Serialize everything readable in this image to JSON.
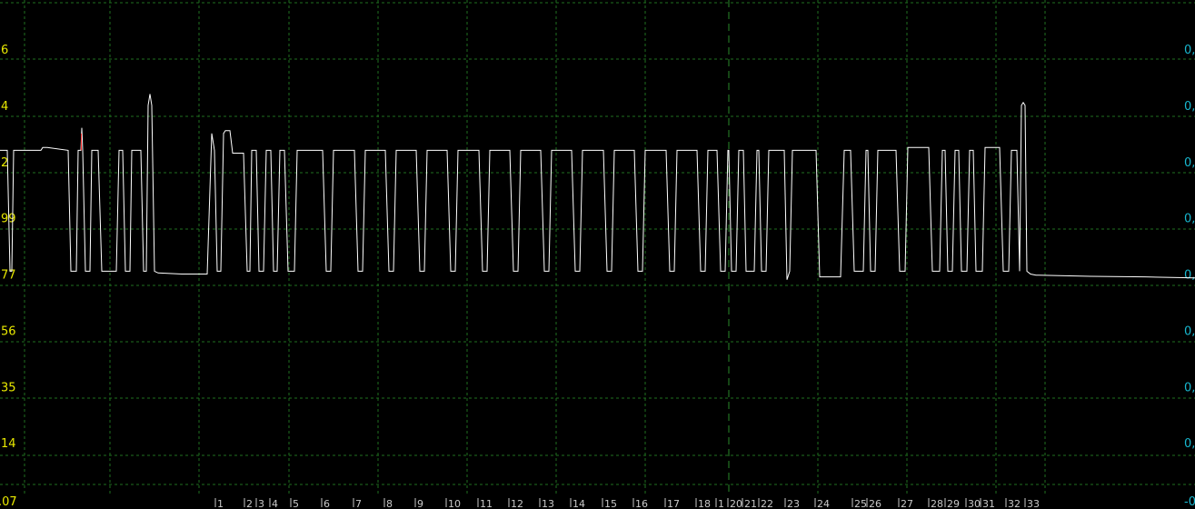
{
  "chart_data": {
    "type": "line",
    "title": "",
    "xlabel": "",
    "ylabel": "",
    "grid": true,
    "colors": {
      "background": "#000000",
      "grid": "#1f6f1f",
      "line": "#ffffff",
      "left_ticks": "#e8e800",
      "right_ticks": "#18b8d0",
      "x_ticks": "#c8c8c8",
      "spike_mark": "#ff3030"
    },
    "xlim": [
      0,
      1315
    ],
    "ylim": [
      -0.5,
      8.5
    ],
    "left_tick_labels": [
      {
        "v": 7,
        "label": "6"
      },
      {
        "v": 6,
        "label": "4"
      },
      {
        "v": 5,
        "label": "2"
      },
      {
        "v": 4,
        "label": "99"
      },
      {
        "v": 3,
        "label": "77"
      },
      {
        "v": 2,
        "label": "56"
      },
      {
        "v": 1,
        "label": "35"
      },
      {
        "v": 0,
        "label": "14"
      },
      {
        "v": -1,
        "label": ".07"
      }
    ],
    "right_tick_labels": [
      {
        "v": 7,
        "label": "0,"
      },
      {
        "v": 6,
        "label": "0,"
      },
      {
        "v": 5,
        "label": "0,"
      },
      {
        "v": 4,
        "label": "0,"
      },
      {
        "v": 3,
        "label": "0,"
      },
      {
        "v": 2,
        "label": "0,"
      },
      {
        "v": 1,
        "label": "0,"
      },
      {
        "v": 0,
        "label": "0,"
      },
      {
        "v": -1,
        "label": "-0"
      }
    ],
    "x_tick_labels": [
      {
        "x": 240,
        "label": "1"
      },
      {
        "x": 272,
        "label": "2"
      },
      {
        "x": 285,
        "label": "3"
      },
      {
        "x": 300,
        "label": "4"
      },
      {
        "x": 323,
        "label": "5"
      },
      {
        "x": 357,
        "label": "6"
      },
      {
        "x": 392,
        "label": "7"
      },
      {
        "x": 426,
        "label": "8"
      },
      {
        "x": 460,
        "label": "9"
      },
      {
        "x": 494,
        "label": "10"
      },
      {
        "x": 529,
        "label": "11"
      },
      {
        "x": 563,
        "label": "12"
      },
      {
        "x": 597,
        "label": "13"
      },
      {
        "x": 631,
        "label": "14"
      },
      {
        "x": 666,
        "label": "15"
      },
      {
        "x": 700,
        "label": "16"
      },
      {
        "x": 735,
        "label": "17"
      },
      {
        "x": 769,
        "label": "18"
      },
      {
        "x": 791,
        "label": "1"
      },
      {
        "x": 804,
        "label": "20"
      },
      {
        "x": 820,
        "label": "21"
      },
      {
        "x": 838,
        "label": "22"
      },
      {
        "x": 867,
        "label": "23"
      },
      {
        "x": 900,
        "label": "24"
      },
      {
        "x": 941,
        "label": "25"
      },
      {
        "x": 957,
        "label": "26"
      },
      {
        "x": 992,
        "label": "27"
      },
      {
        "x": 1025,
        "label": "28"
      },
      {
        "x": 1043,
        "label": "29"
      },
      {
        "x": 1066,
        "label": "30"
      },
      {
        "x": 1082,
        "label": "31"
      },
      {
        "x": 1110,
        "label": "32"
      },
      {
        "x": 1131,
        "label": "33"
      }
    ],
    "pattern_points": [
      [
        0,
        5.2
      ],
      [
        8,
        5.2
      ],
      [
        11,
        3.05
      ],
      [
        13,
        3.05
      ],
      [
        15,
        5.2
      ],
      [
        45,
        5.2
      ],
      [
        47,
        5.25
      ],
      [
        52,
        5.25
      ],
      [
        75,
        5.2
      ],
      [
        78,
        3.05
      ],
      [
        84,
        3.05
      ],
      [
        86,
        5.2
      ],
      [
        89,
        5.2
      ],
      [
        90,
        5.6
      ],
      [
        91,
        5.2
      ],
      [
        94,
        3.05
      ],
      [
        99,
        3.05
      ],
      [
        101,
        5.2
      ],
      [
        108,
        5.2
      ],
      [
        112,
        3.05
      ],
      [
        128,
        3.05
      ],
      [
        131,
        5.2
      ],
      [
        135,
        5.2
      ],
      [
        138,
        3.05
      ],
      [
        143,
        3.05
      ],
      [
        145,
        5.2
      ],
      [
        155,
        5.2
      ],
      [
        158,
        3.05
      ],
      [
        161,
        3.05
      ],
      [
        163,
        6.0
      ],
      [
        165,
        6.2
      ],
      [
        167,
        6.0
      ],
      [
        170,
        3.05
      ],
      [
        174,
        3.02
      ],
      [
        200,
        3.0
      ],
      [
        228,
        3.0
      ],
      [
        231,
        4.5
      ],
      [
        233,
        5.5
      ],
      [
        236,
        5.2
      ],
      [
        239,
        3.05
      ],
      [
        243,
        3.05
      ],
      [
        246,
        5.5
      ],
      [
        248,
        5.55
      ],
      [
        253,
        5.55
      ],
      [
        256,
        5.15
      ],
      [
        268,
        5.15
      ],
      [
        272,
        3.05
      ],
      [
        275,
        3.05
      ],
      [
        277,
        5.2
      ],
      [
        282,
        5.2
      ],
      [
        285,
        3.05
      ],
      [
        290,
        3.05
      ],
      [
        293,
        5.2
      ],
      [
        298,
        5.2
      ],
      [
        301,
        3.05
      ],
      [
        305,
        3.05
      ],
      [
        308,
        5.2
      ],
      [
        313,
        5.2
      ],
      [
        317,
        3.05
      ],
      [
        324,
        3.05
      ],
      [
        327,
        5.2
      ],
      [
        355,
        5.2
      ],
      [
        359,
        3.05
      ],
      [
        364,
        3.05
      ],
      [
        367,
        5.2
      ],
      [
        390,
        5.2
      ],
      [
        394,
        3.05
      ],
      [
        399,
        3.05
      ],
      [
        402,
        5.2
      ],
      [
        424,
        5.2
      ],
      [
        428,
        3.05
      ],
      [
        433,
        3.05
      ],
      [
        436,
        5.2
      ],
      [
        458,
        5.2
      ],
      [
        462,
        3.05
      ],
      [
        467,
        3.05
      ],
      [
        470,
        5.2
      ],
      [
        492,
        5.2
      ],
      [
        496,
        3.05
      ],
      [
        501,
        3.05
      ],
      [
        504,
        5.2
      ],
      [
        527,
        5.2
      ],
      [
        531,
        3.05
      ],
      [
        536,
        3.05
      ],
      [
        539,
        5.2
      ],
      [
        561,
        5.2
      ],
      [
        565,
        3.05
      ],
      [
        570,
        3.05
      ],
      [
        573,
        5.2
      ],
      [
        595,
        5.2
      ],
      [
        599,
        3.05
      ],
      [
        604,
        3.05
      ],
      [
        607,
        5.2
      ],
      [
        629,
        5.2
      ],
      [
        633,
        3.05
      ],
      [
        638,
        3.05
      ],
      [
        641,
        5.2
      ],
      [
        664,
        5.2
      ],
      [
        668,
        3.05
      ],
      [
        673,
        3.05
      ],
      [
        676,
        5.2
      ],
      [
        698,
        5.2
      ],
      [
        702,
        3.05
      ],
      [
        707,
        3.05
      ],
      [
        710,
        5.2
      ],
      [
        733,
        5.2
      ],
      [
        737,
        3.05
      ],
      [
        742,
        3.05
      ],
      [
        745,
        5.2
      ],
      [
        767,
        5.2
      ],
      [
        771,
        3.05
      ],
      [
        776,
        3.05
      ],
      [
        779,
        5.2
      ],
      [
        789,
        5.2
      ],
      [
        793,
        3.05
      ],
      [
        798,
        3.05
      ],
      [
        801,
        5.2
      ],
      [
        802,
        5.2
      ],
      [
        805,
        3.05
      ],
      [
        810,
        3.05
      ],
      [
        813,
        5.2
      ],
      [
        818,
        5.2
      ],
      [
        821,
        3.05
      ],
      [
        830,
        3.05
      ],
      [
        833,
        5.2
      ],
      [
        835,
        5.2
      ],
      [
        838,
        3.05
      ],
      [
        843,
        3.05
      ],
      [
        846,
        5.2
      ],
      [
        863,
        5.2
      ],
      [
        866,
        2.9
      ],
      [
        869,
        3.05
      ],
      [
        872,
        5.2
      ],
      [
        898,
        5.2
      ],
      [
        902,
        2.95
      ],
      [
        925,
        2.95
      ],
      [
        929,
        5.2
      ],
      [
        936,
        5.2
      ],
      [
        940,
        3.05
      ],
      [
        950,
        3.05
      ],
      [
        953,
        5.2
      ],
      [
        955,
        5.2
      ],
      [
        958,
        3.05
      ],
      [
        963,
        3.05
      ],
      [
        966,
        5.2
      ],
      [
        986,
        5.2
      ],
      [
        990,
        3.05
      ],
      [
        996,
        3.05
      ],
      [
        999,
        5.25
      ],
      [
        1022,
        5.25
      ],
      [
        1026,
        3.05
      ],
      [
        1034,
        3.05
      ],
      [
        1037,
        5.2
      ],
      [
        1040,
        5.2
      ],
      [
        1043,
        3.05
      ],
      [
        1048,
        3.05
      ],
      [
        1051,
        5.2
      ],
      [
        1055,
        5.2
      ],
      [
        1058,
        3.05
      ],
      [
        1064,
        3.05
      ],
      [
        1067,
        5.2
      ],
      [
        1071,
        5.2
      ],
      [
        1074,
        3.05
      ],
      [
        1081,
        3.05
      ],
      [
        1084,
        5.25
      ],
      [
        1100,
        5.25
      ],
      [
        1104,
        3.05
      ],
      [
        1110,
        3.05
      ],
      [
        1113,
        5.2
      ],
      [
        1119,
        5.2
      ],
      [
        1122,
        3.05
      ],
      [
        1124,
        6.0
      ],
      [
        1126,
        6.05
      ],
      [
        1128,
        6.0
      ],
      [
        1130,
        3.05
      ],
      [
        1134,
        3.0
      ],
      [
        1140,
        2.98
      ],
      [
        1200,
        2.96
      ],
      [
        1260,
        2.95
      ],
      [
        1315,
        2.93
      ]
    ]
  }
}
